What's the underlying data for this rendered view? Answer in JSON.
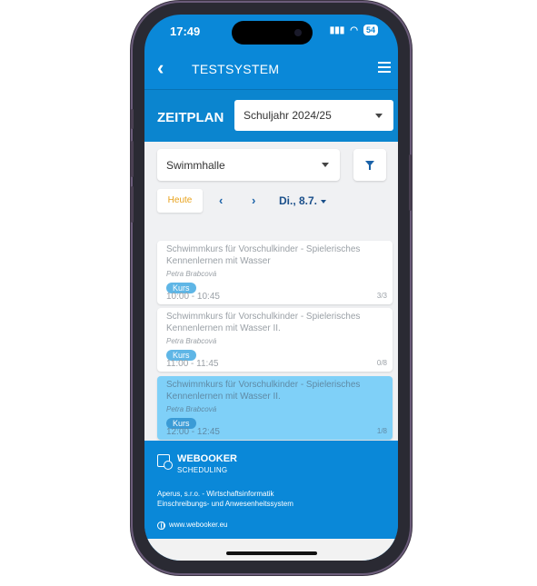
{
  "status_bar": {
    "time": "17:49",
    "battery": "54"
  },
  "app_bar": {
    "title": "TESTSYSTEM"
  },
  "schedule_header": {
    "label": "ZEITPLAN",
    "school_year": "Schuljahr 2024/25"
  },
  "filters": {
    "location": "Swimmhalle"
  },
  "date_nav": {
    "today_label": "Heute",
    "prev": "‹",
    "next": "›",
    "date": "Di., 8.7."
  },
  "events": [
    {
      "title": "Schwimmkurs für Vorschulkinder - Spielerisches Kennenlernen mit Wasser",
      "trainer": "Petra Brabcová",
      "badge": "Kurs",
      "time": "10:00 - 10:45",
      "capacity": "3/3",
      "selected": false
    },
    {
      "title": "Schwimmkurs für Vorschulkinder - Spielerisches Kennenlernen mit Wasser II.",
      "trainer": "Petra Brabcová",
      "badge": "Kurs",
      "time": "11:00 - 11:45",
      "capacity": "0/8",
      "selected": false
    },
    {
      "title": "Schwimmkurs für Vorschulkinder - Spielerisches Kennenlernen mit Wasser II.",
      "trainer": "Petra Brabcová",
      "badge": "Kurs",
      "time": "12:00 - 12:45",
      "capacity": "1/8",
      "selected": true
    }
  ],
  "footer": {
    "brand_line1": "WEBOOKER",
    "brand_line2": "SCHEDULING",
    "company_line1": "Aperus, s.r.o. - Wirtschaftsinformatik",
    "company_line2": "Einschreibungs- und Anwesenheitssystem",
    "website": "www.webooker.eu"
  },
  "colors": {
    "primary": "#0a88d8",
    "accent_today": "#e8a21c",
    "selected_event": "#7fd0f8",
    "badge": "#5fb6e6"
  },
  "icons": [
    "back-arrow-icon",
    "hamburger-menu-icon",
    "filter-funnel-icon",
    "calendar-clock-icon",
    "globe-icon"
  ]
}
